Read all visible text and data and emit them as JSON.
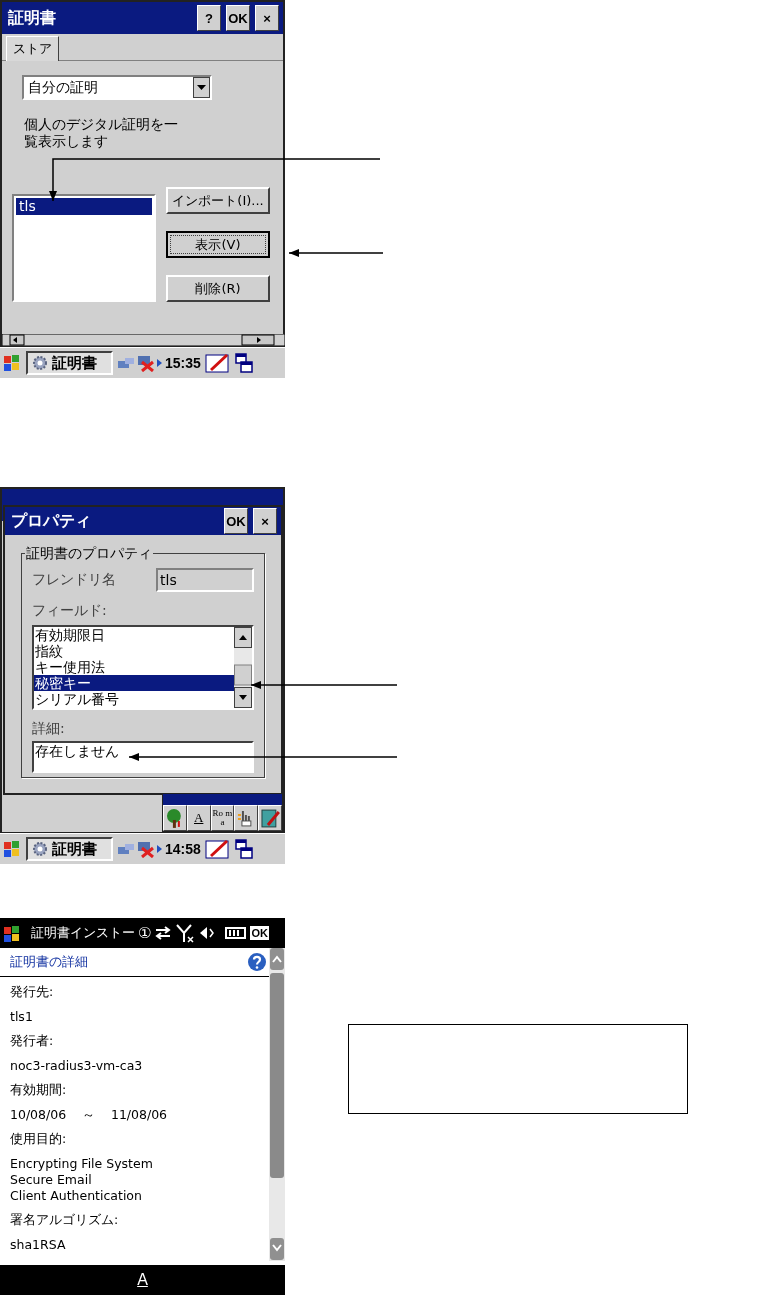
{
  "screen_1": {
    "title": "証明書",
    "title_buttons": [
      "?",
      "OK",
      "×"
    ],
    "tabs": [
      {
        "label": "ストア",
        "selected": true
      }
    ],
    "dropdown": {
      "value": "自分の証明"
    },
    "description": "個人のデジタル証明を一覧表示します",
    "list": [
      {
        "label": "tls",
        "selected": true
      }
    ],
    "buttons": [
      {
        "label": "インポート(I)...",
        "focused": false
      },
      {
        "label": "表示(V)",
        "focused": true
      },
      {
        "label": "削除(R)",
        "focused": false
      }
    ],
    "taskbar": {
      "app": "証明書",
      "time": "15:35"
    }
  },
  "screen_2": {
    "dialog": {
      "title": "プロパティ",
      "title_buttons": [
        "OK",
        "×"
      ],
      "group": "証明書のプロパティ",
      "friendly_name_label": "フレンドリ名",
      "friendly_name": "tls",
      "fields_label": "フィールド:",
      "fields": [
        {
          "label": "有効期限日",
          "selected": false
        },
        {
          "label": "指紋",
          "selected": false
        },
        {
          "label": "キー使用法",
          "selected": false
        },
        {
          "label": "秘密キー",
          "selected": true
        },
        {
          "label": "シリアル番号",
          "selected": false
        }
      ],
      "detail_label": "詳細:",
      "detail": "存在しません"
    },
    "input_panel": {
      "keys": [
        "A",
        "Ro ma"
      ]
    },
    "taskbar": {
      "app": "証明書",
      "time": "14:58"
    }
  },
  "screen_3": {
    "title": "証明書インストー",
    "badge": "①",
    "ok": "OK",
    "header": "証明書の詳細",
    "sections": [
      {
        "label": "発行先:",
        "lines": [
          "tls1"
        ]
      },
      {
        "label": "発行者:",
        "lines": [
          "noc3-radius3-vm-ca3"
        ]
      },
      {
        "label": "有効期間:",
        "lines": [
          "10/08/06    ～    11/08/06"
        ]
      },
      {
        "label": "使用目的:",
        "lines": [
          "Encrypting File System",
          "Secure Email",
          "Client Authentication"
        ]
      },
      {
        "label": "署名アルゴリズム:",
        "lines": [
          "sha1RSA"
        ]
      }
    ],
    "bottom_key": "A"
  }
}
